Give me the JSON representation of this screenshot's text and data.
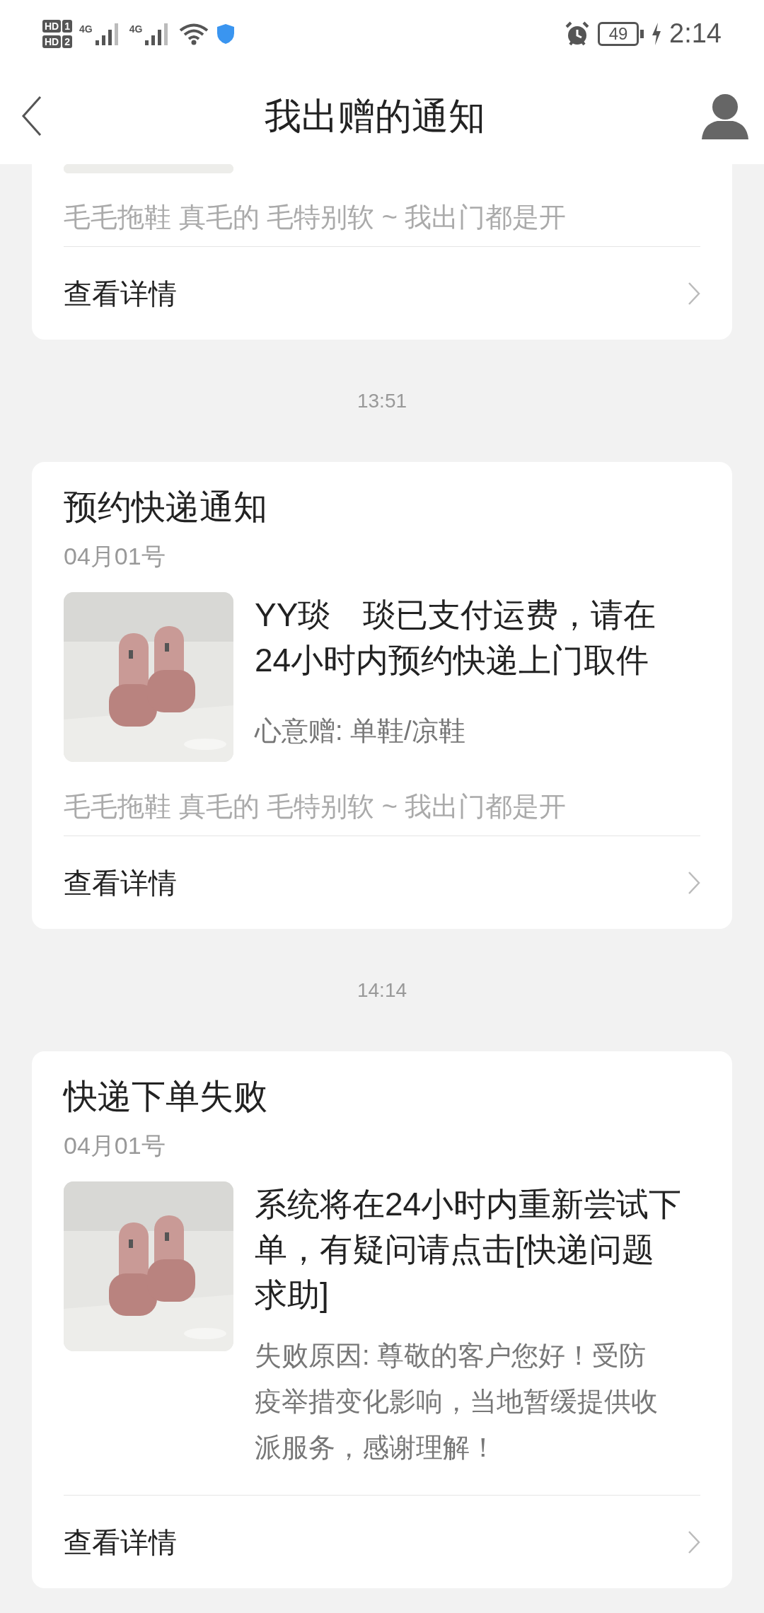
{
  "status_bar": {
    "sim_badges": [
      {
        "label": "HD",
        "slot": "1"
      },
      {
        "label": "HD",
        "slot": "2"
      }
    ],
    "networks": [
      "4G",
      "4G"
    ],
    "battery": "49",
    "time": "2:14"
  },
  "header": {
    "title": "我出赠的通知"
  },
  "cards": [
    {
      "kind": "partial",
      "description": "毛毛拖鞋 真毛的 毛特别软 ~ 我出门都是开",
      "action": "查看详情"
    },
    {
      "kind": "gift",
      "time": "13:51",
      "title": "预约快递通知",
      "date": "04月01号",
      "message": "YY琰　琰已支付运费，请在24小时内预约快递上门取件",
      "note": "心意赠: 单鞋/凉鞋",
      "description": "毛毛拖鞋 真毛的 毛特别软 ~ 我出门都是开",
      "action": "查看详情"
    },
    {
      "kind": "failure",
      "time": "14:14",
      "title": "快递下单失败",
      "date": "04月01号",
      "message": "系统将在24小时内重新尝试下单，有疑问请点击[快递问题求助]",
      "note": "失败原因: 尊敬的客户您好！受防疫举措变化影响，当地暂缓提供收派服务，感谢理解！",
      "action": "查看详情"
    }
  ]
}
